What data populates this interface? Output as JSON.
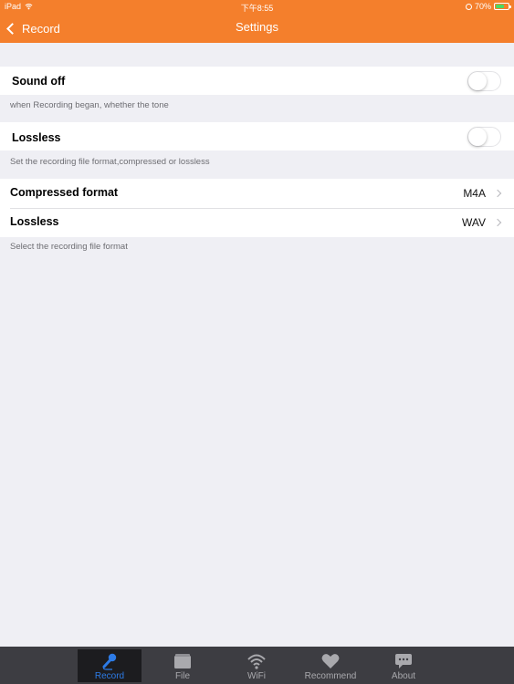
{
  "status_bar": {
    "device": "iPad",
    "time": "下午8:55",
    "battery_text": "70%",
    "battery_level": 0.7
  },
  "nav": {
    "back_label": "Record",
    "title": "Settings"
  },
  "settings": {
    "sound_off": {
      "label": "Sound off",
      "enabled": false,
      "footer": "when Recording began, whether the tone"
    },
    "lossless_toggle": {
      "label": "Lossless",
      "enabled": false,
      "footer": "Set the recording file format,compressed or lossless"
    },
    "formats": {
      "compressed": {
        "label": "Compressed format",
        "value": "M4A"
      },
      "lossless": {
        "label": "Lossless",
        "value": "WAV"
      },
      "footer": "Select the recording file format"
    }
  },
  "tabbar": {
    "tabs": [
      {
        "label": "Record",
        "icon": "microphone-icon",
        "active": true
      },
      {
        "label": "File",
        "icon": "folder-icon",
        "active": false
      },
      {
        "label": "WiFi",
        "icon": "wifi-icon",
        "active": false
      },
      {
        "label": "Recommend",
        "icon": "heart-icon",
        "active": false
      },
      {
        "label": "About",
        "icon": "chat-bubble-icon",
        "active": false
      }
    ]
  },
  "colors": {
    "accent": "#f47f2c",
    "tab_active": "#2d7be6",
    "tabbar_bg": "#3d3d42",
    "page_bg": "#efeff4",
    "battery": "#4cd964"
  }
}
